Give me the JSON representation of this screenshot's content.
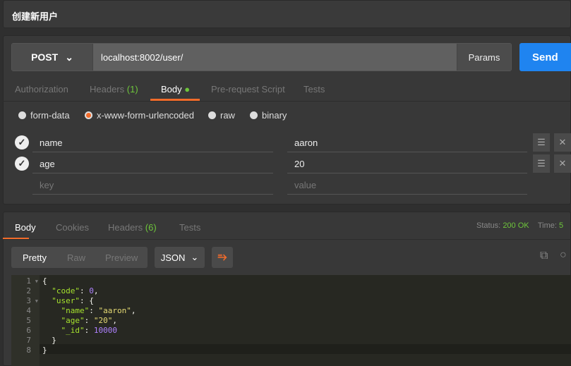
{
  "title": "创建新用户",
  "request": {
    "method": "POST",
    "url": "localhost:8002/user/",
    "params_label": "Params",
    "send_label": "Send",
    "tabs": [
      {
        "label": "Authorization"
      },
      {
        "label": "Headers",
        "count": "(1)"
      },
      {
        "label": "Body"
      },
      {
        "label": "Pre-request Script"
      },
      {
        "label": "Tests"
      }
    ],
    "body_modes": [
      "form-data",
      "x-www-form-urlencoded",
      "raw",
      "binary"
    ],
    "selected_mode": "x-www-form-urlencoded",
    "rows": [
      {
        "key": "name",
        "value": "aaron",
        "checked": true
      },
      {
        "key": "age",
        "value": "20",
        "checked": true
      }
    ],
    "key_placeholder": "key",
    "value_placeholder": "value"
  },
  "response": {
    "tabs": [
      {
        "label": "Body"
      },
      {
        "label": "Cookies"
      },
      {
        "label": "Headers",
        "count": "(6)"
      },
      {
        "label": "Tests"
      }
    ],
    "status_label": "Status:",
    "status_value": "200 OK",
    "time_label": "Time:",
    "time_value": "5",
    "views": [
      "Pretty",
      "Raw",
      "Preview"
    ],
    "format": "JSON",
    "lines": [
      {
        "n": "1",
        "fold": true
      },
      {
        "n": "2"
      },
      {
        "n": "3",
        "fold": true
      },
      {
        "n": "4"
      },
      {
        "n": "5"
      },
      {
        "n": "6"
      },
      {
        "n": "7"
      },
      {
        "n": "8"
      }
    ],
    "code": {
      "l1": "{",
      "code_key": "\"code\"",
      "code_val": "0",
      "user_key": "\"user\"",
      "name_key": "\"name\"",
      "name_val": "\"aaron\"",
      "age_key": "\"age\"",
      "age_val": "\"20\"",
      "id_key": "\"_id\"",
      "id_val": "10000",
      "close_inner": "}",
      "close_outer": "}"
    }
  },
  "colors": {
    "accent": "#f26b2a",
    "send": "#1f84f0",
    "green": "#6ec63b"
  }
}
